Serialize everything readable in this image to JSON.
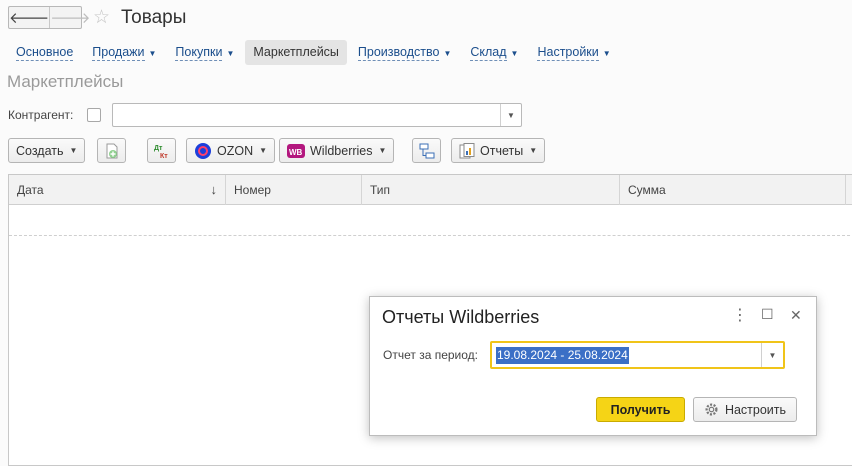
{
  "window": {
    "title": "Товары",
    "back_glyph": "🡐",
    "forward_glyph": "🡒",
    "star_glyph": "☆"
  },
  "sections": [
    {
      "label": "Основное",
      "has_menu": false,
      "active": false
    },
    {
      "label": "Продажи",
      "has_menu": true,
      "active": false
    },
    {
      "label": "Покупки",
      "has_menu": true,
      "active": false
    },
    {
      "label": "Маркетплейсы",
      "has_menu": false,
      "active": true
    },
    {
      "label": "Производство",
      "has_menu": true,
      "active": false
    },
    {
      "label": "Склад",
      "has_menu": true,
      "active": false
    },
    {
      "label": "Настройки",
      "has_menu": true,
      "active": false
    }
  ],
  "form": {
    "title": "Маркетплейсы",
    "filter": {
      "label": "Контрагент:",
      "value": "",
      "checked": false
    }
  },
  "toolbar": {
    "create_label": "Создать",
    "ozon_label": "OZON",
    "wb_label": "Wildberries",
    "reports_label": "Отчеты",
    "dtkt_top": "Дт",
    "dtkt_bottom": "Кт",
    "wb_badge": "WB"
  },
  "table": {
    "columns": [
      "Дата",
      "Номер",
      "Тип",
      "Сумма"
    ],
    "sort_glyph": "↓",
    "rows": []
  },
  "dialog": {
    "title": "Отчеты Wildberries",
    "period_label": "Отчет за период:",
    "period_value": "19.08.2024 - 25.08.2024",
    "ok_label": "Получить",
    "settings_label": "Настроить",
    "more_glyph": "⋮",
    "maximize_glyph": "☐",
    "close_glyph": "✕"
  },
  "colors": {
    "accent_yellow": "#f5d416",
    "link_blue": "#1b4e8c",
    "wb_purple": "#b3177e",
    "ozon_blue": "#1c3fdb"
  }
}
